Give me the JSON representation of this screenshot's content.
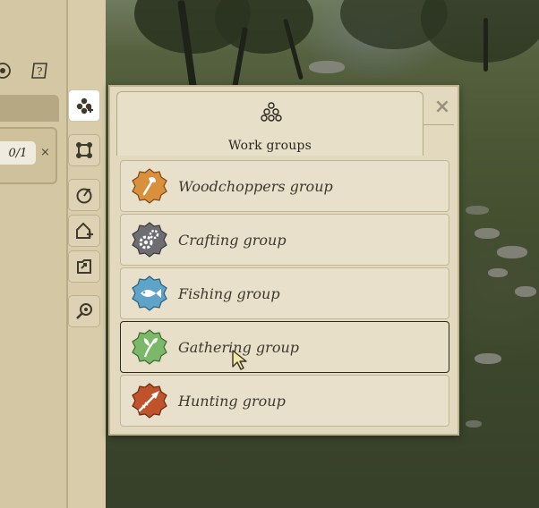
{
  "popup": {
    "title": "Work groups",
    "close_symbol": "×",
    "groups": [
      {
        "label": "Woodchoppers group",
        "icon": "axe-icon",
        "color": "#d98f3c"
      },
      {
        "label": "Crafting group",
        "icon": "gears-icon",
        "color": "#6e6e72"
      },
      {
        "label": "Fishing group",
        "icon": "fish-icon",
        "color": "#5fa3c8"
      },
      {
        "label": "Gathering group",
        "icon": "herb-icon",
        "color": "#7bb86a"
      },
      {
        "label": "Hunting group",
        "icon": "spear-icon",
        "color": "#c0532a"
      }
    ],
    "hovered_group": "Gathering group"
  },
  "left_panel": {
    "count": "0/1",
    "remove_symbol": "×",
    "top_icons": [
      "eye-icon",
      "help-scroll-icon"
    ]
  },
  "toolbar": {
    "buttons": [
      "work-groups-icon",
      "area-icon",
      "priority-icon",
      "add-building-icon",
      "assign-icon",
      "search-icon"
    ],
    "active": "work-groups-icon"
  }
}
